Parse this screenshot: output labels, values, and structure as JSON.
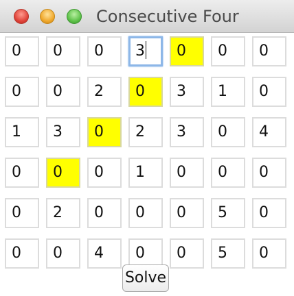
{
  "window": {
    "title": "Consecutive Four"
  },
  "board": {
    "rows": [
      [
        "0",
        "0",
        "0",
        "3",
        "0",
        "0",
        "0"
      ],
      [
        "0",
        "0",
        "2",
        "0",
        "3",
        "1",
        "0"
      ],
      [
        "1",
        "3",
        "0",
        "2",
        "3",
        "0",
        "4"
      ],
      [
        "0",
        "0",
        "0",
        "1",
        "0",
        "0",
        "0"
      ],
      [
        "0",
        "2",
        "0",
        "0",
        "0",
        "5",
        "0"
      ],
      [
        "0",
        "0",
        "4",
        "0",
        "0",
        "5",
        "0"
      ]
    ],
    "highlighted": [
      [
        0,
        4
      ],
      [
        1,
        3
      ],
      [
        2,
        2
      ],
      [
        3,
        1
      ]
    ],
    "focused": [
      0,
      3
    ],
    "highlight_color": "#ffff00",
    "focus_color": "#8db7e8"
  },
  "actions": {
    "solve_label": "Solve"
  }
}
